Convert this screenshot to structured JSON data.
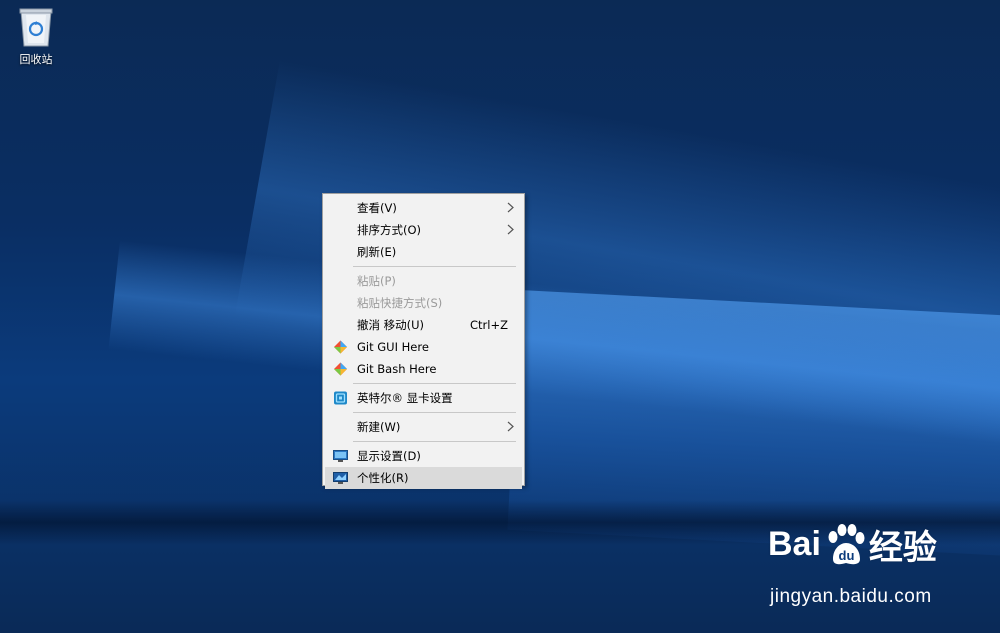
{
  "desktop": {
    "icons": [
      {
        "label": "回收站",
        "icon": "recycle-bin-icon"
      }
    ]
  },
  "context_menu": {
    "items": [
      {
        "label": "查看(V)",
        "submenu": true
      },
      {
        "label": "排序方式(O)",
        "submenu": true
      },
      {
        "label": "刷新(E)"
      },
      {
        "label": "粘贴(P)",
        "disabled": true
      },
      {
        "label": "粘贴快捷方式(S)",
        "disabled": true
      },
      {
        "label": "撤消 移动(U)",
        "shortcut": "Ctrl+Z"
      },
      {
        "label": "Git GUI Here",
        "icon": "git-icon"
      },
      {
        "label": "Git Bash Here",
        "icon": "git-icon"
      },
      {
        "label": "英特尔® 显卡设置",
        "icon": "intel-graphics-icon"
      },
      {
        "label": "新建(W)",
        "submenu": true
      },
      {
        "label": "显示设置(D)",
        "icon": "display-icon"
      },
      {
        "label": "个性化(R)",
        "icon": "personalize-icon",
        "highlighted": true
      }
    ]
  },
  "watermark": {
    "logo_left": "Bai",
    "logo_right": "经验",
    "url": "jingyan.baidu.com"
  },
  "colors": {
    "menu_bg": "#f2f2f2",
    "menu_highlight": "#dadada",
    "disabled_text": "#9a9a9a",
    "desktop_blue": "#0b3b7c"
  }
}
